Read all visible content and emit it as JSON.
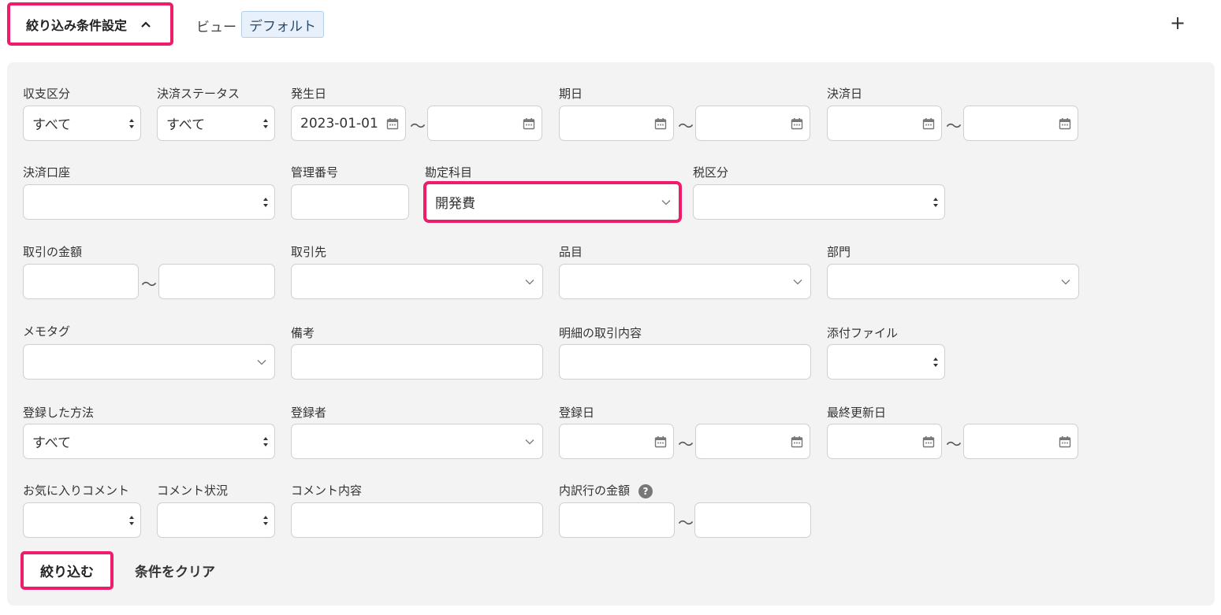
{
  "header": {
    "toggle_label": "絞り込み条件設定",
    "view_label": "ビュー",
    "view_value": "デフォルト",
    "add_label": "+"
  },
  "filters": {
    "income_expense": {
      "label": "収支区分",
      "value": "すべて"
    },
    "settlement_status": {
      "label": "決済ステータス",
      "value": "すべて"
    },
    "occurrence_date": {
      "label": "発生日",
      "from": "2023-01-01",
      "to": ""
    },
    "due_date": {
      "label": "期日",
      "from": "",
      "to": ""
    },
    "settlement_date": {
      "label": "決済日",
      "from": "",
      "to": ""
    },
    "settlement_account": {
      "label": "決済口座",
      "value": ""
    },
    "management_number": {
      "label": "管理番号",
      "value": ""
    },
    "account_item": {
      "label": "勘定科目",
      "value": "開発費"
    },
    "tax_category": {
      "label": "税区分",
      "value": ""
    },
    "amount": {
      "label": "取引の金額",
      "from": "",
      "to": ""
    },
    "partner": {
      "label": "取引先",
      "value": ""
    },
    "item": {
      "label": "品目",
      "value": ""
    },
    "department": {
      "label": "部門",
      "value": ""
    },
    "memo_tag": {
      "label": "メモタグ",
      "value": ""
    },
    "remarks": {
      "label": "備考",
      "value": ""
    },
    "detail_description": {
      "label": "明細の取引内容",
      "value": ""
    },
    "attachment": {
      "label": "添付ファイル",
      "value": ""
    },
    "registration_method": {
      "label": "登録した方法",
      "value": "すべて"
    },
    "registrant": {
      "label": "登録者",
      "value": ""
    },
    "registration_date": {
      "label": "登録日",
      "from": "",
      "to": ""
    },
    "last_updated": {
      "label": "最終更新日",
      "from": "",
      "to": ""
    },
    "favorite_comment": {
      "label": "お気に入りコメント",
      "value": ""
    },
    "comment_status": {
      "label": "コメント状況",
      "value": ""
    },
    "comment_content": {
      "label": "コメント内容",
      "value": ""
    },
    "breakdown_amount": {
      "label": "内訳行の金額",
      "from": "",
      "to": "",
      "help": "?"
    }
  },
  "range_separator": "〜",
  "actions": {
    "apply_label": "絞り込む",
    "clear_label": "条件をクリア"
  },
  "colors": {
    "highlight": "#ee1c6a",
    "panel_bg": "#f4f3f3",
    "chip_bg": "#e8f1fb"
  }
}
